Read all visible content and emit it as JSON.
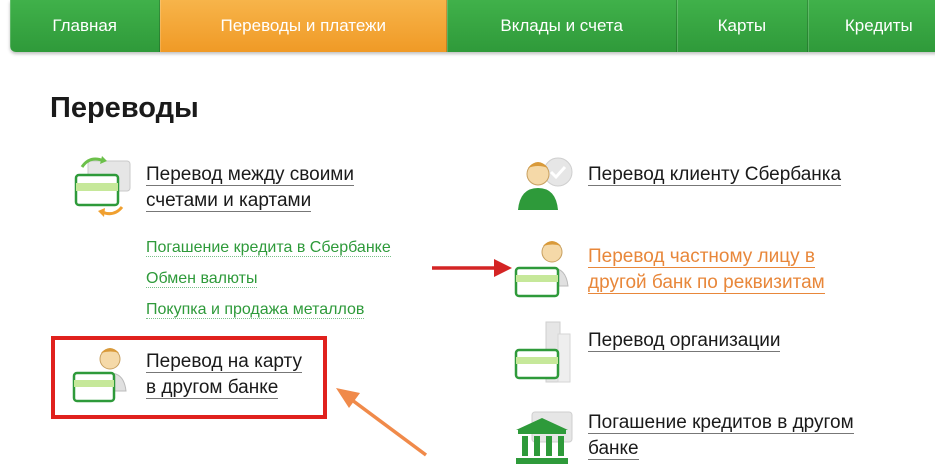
{
  "nav": {
    "items": [
      {
        "label": "Главная",
        "active": false
      },
      {
        "label": "Переводы и платежи",
        "active": true
      },
      {
        "label": "Вклады и счета",
        "active": false
      },
      {
        "label": "Карты",
        "active": false
      },
      {
        "label": "Кредиты",
        "active": false
      }
    ]
  },
  "page": {
    "title": "Переводы"
  },
  "links": {
    "own_accounts": [
      "Перевод между своими",
      "счетами и картами"
    ],
    "sub": [
      "Погашение кредита в Сбербанке",
      "Обмен валюты",
      "Покупка и продажа металлов"
    ],
    "card_other_bank": [
      "Перевод на карту",
      "в другом банке"
    ],
    "sber_client": [
      "Перевод клиенту Сбербанка"
    ],
    "private_person": [
      "Перевод частному лицу в",
      "другой банк по реквизитам"
    ],
    "organization": [
      "Перевод организации"
    ],
    "loan_other_bank": [
      "Погашение кредитов в другом",
      "банке"
    ]
  },
  "colors": {
    "brand_green": "#30a43c",
    "accent_orange": "#f0a030",
    "link_green": "#2e9a3a",
    "link_orange": "#e8873a",
    "highlight_red": "#e0211d"
  },
  "icons": [
    "exchange-card-icon",
    "person-check-icon",
    "person-card-icon",
    "building-card-icon",
    "bank-icon"
  ]
}
